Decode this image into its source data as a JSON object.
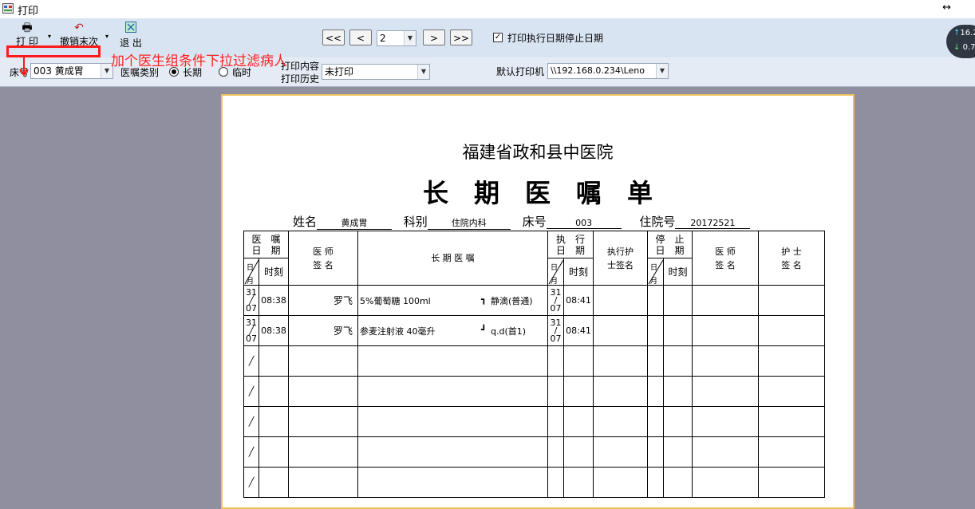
{
  "window": {
    "title": "打印"
  },
  "toolbar": {
    "print": "打 印",
    "undo": "撤销末次",
    "exit": "退 出",
    "first": "<<",
    "prev": "<",
    "page": "2",
    "next": ">",
    "last": ">>",
    "print_date_check": "打印执行日期停止日期"
  },
  "filter": {
    "bed_label": "床号",
    "bed_value": "003 黄成胃",
    "order_type_label": "医嘱类别",
    "long_term": "长期",
    "temporary": "临时",
    "print_content": "打印内容",
    "print_history": "打印历史",
    "print_status": "未打印",
    "printer_label": "默认打印机",
    "printer_value": "\\\\192.168.0.234\\Leno"
  },
  "annotation": "加个医生组条件下拉过滤病人",
  "badge": {
    "up": "16.2",
    "down": "0.7"
  },
  "sheet": {
    "hospital": "福建省政和县中医院",
    "title": "长　期　医　嘱　单",
    "name_label": "姓名",
    "name_value": "黄成胃",
    "dept_label": "科别",
    "dept_value": "住院内科",
    "bed_label": "床号",
    "bed_value": "003",
    "admission_label": "住院号",
    "admission_value": "20172521",
    "headers": {
      "order_date": "医　嘱<br>日　期",
      "date": "日月",
      "time": "时刻",
      "doctor_sign": "医 师<br>签 名",
      "order": "长 期 医 嘱",
      "exec_date": "执　行<br>日　期",
      "exec_nurse": "执行护<br>士签名",
      "stop_date": "停　止<br>日　期",
      "doctor_sign2": "医 师<br>签 名",
      "nurse_sign": "护 士<br>签 名"
    },
    "rows": [
      {
        "day": "31",
        "mon": "07",
        "time": "08:38",
        "doctor": "罗飞",
        "order": "5%葡萄糖 100ml",
        "route": "静滴(普通)",
        "bracket": "┓",
        "exec_day": "31",
        "exec_mon": "07",
        "exec_time": "08:41"
      },
      {
        "day": "31",
        "mon": "07",
        "time": "08:38",
        "doctor": "罗飞",
        "order": "参麦注射液 40毫升",
        "route": "q.d(首1)",
        "bracket": "┛",
        "exec_day": "31",
        "exec_mon": "07",
        "exec_time": "08:41"
      }
    ]
  }
}
